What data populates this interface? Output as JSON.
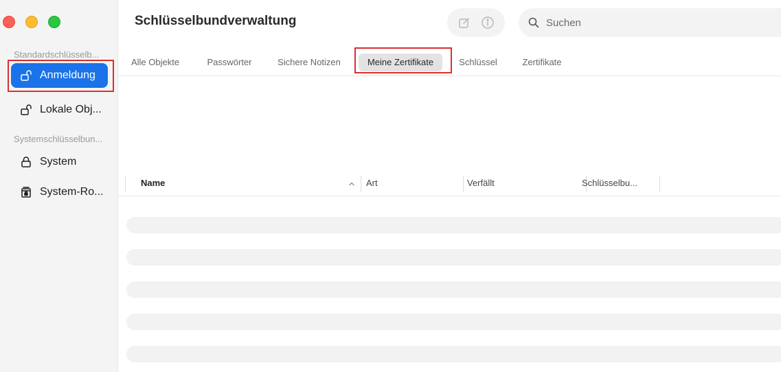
{
  "app": {
    "title": "Schlüsselbundverwaltung"
  },
  "traffic_lights": {
    "close": "#ff5f57",
    "minimize": "#febc2e",
    "zoom": "#28c840"
  },
  "sidebar": {
    "sections": [
      {
        "label": "Standardschlüsselb...",
        "items": [
          {
            "label": "Anmeldung",
            "icon": "lock-open-icon",
            "active": true
          },
          {
            "label": "Lokale Obj...",
            "icon": "lock-open-icon",
            "active": false
          }
        ]
      },
      {
        "label": "Systemschlüsselbun...",
        "items": [
          {
            "label": "System",
            "icon": "lock-icon",
            "active": false
          },
          {
            "label": "System-Ro...",
            "icon": "cabinet-lock-icon",
            "active": false
          }
        ]
      }
    ]
  },
  "toolbar": {
    "edit_icon": "compose-icon",
    "info_icon": "info-icon"
  },
  "search": {
    "placeholder": "Suchen",
    "value": ""
  },
  "tabs": [
    {
      "label": "Alle Objekte",
      "active": false
    },
    {
      "label": "Passwörter",
      "active": false
    },
    {
      "label": "Sichere Notizen",
      "active": false
    },
    {
      "label": "Meine Zertifikate",
      "active": true
    },
    {
      "label": "Schlüssel",
      "active": false
    },
    {
      "label": "Zertifikate",
      "active": false
    }
  ],
  "table": {
    "columns": [
      {
        "label": "Name",
        "sorted": "ascending"
      },
      {
        "label": "Art"
      },
      {
        "label": "Verfällt"
      },
      {
        "label": "Schlüsselbu..."
      }
    ],
    "rows": []
  },
  "colors": {
    "accent": "#1a73e8",
    "highlight_box": "#d93030",
    "sidebar_bg": "#f4f4f4"
  }
}
